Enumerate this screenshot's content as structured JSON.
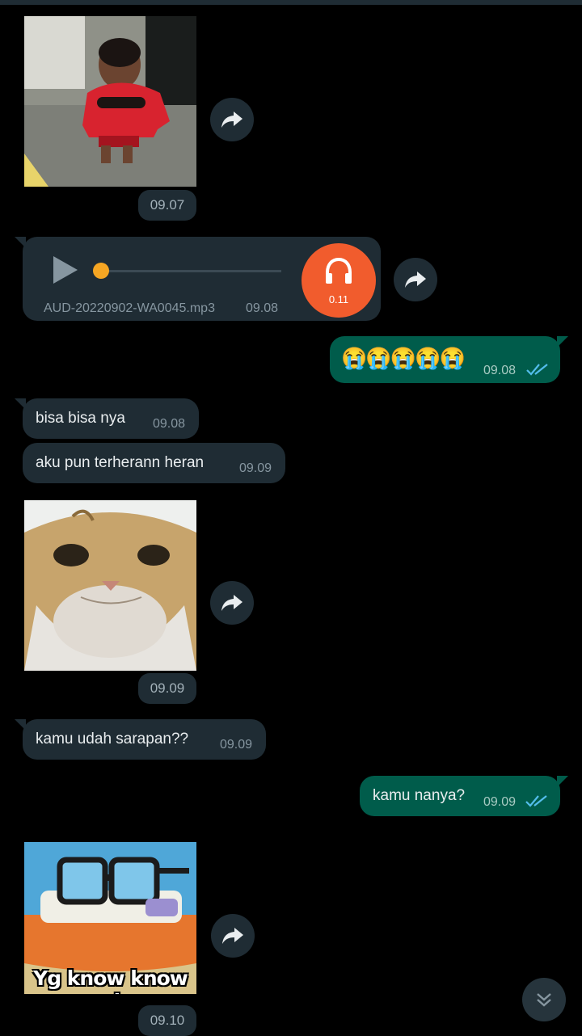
{
  "messages": {
    "img1_time": "09.07",
    "audio": {
      "filename": "AUD-20220902-WA0045.mp3",
      "time": "09.08",
      "duration": "0.11",
      "progress": 0
    },
    "out1": {
      "text": "😭😭😭😭😭",
      "time": "09.08"
    },
    "in1": {
      "text": "bisa bisa nya",
      "time": "09.08"
    },
    "in2": {
      "text": "aku pun terherann heran",
      "time": "09.09"
    },
    "img2_time": "09.09",
    "in3": {
      "text": "kamu udah sarapan??",
      "time": "09.09"
    },
    "out2": {
      "text": "kamu nanya?",
      "time": "09.09"
    },
    "img3": {
      "caption": "Yg know know aj",
      "time": "09.10"
    }
  },
  "colors": {
    "background": "#000000",
    "incoming_bubble": "#1f2c34",
    "outgoing_bubble": "#005c4b",
    "read_ticks": "#53bdeb",
    "audio_accent": "#f15c2d",
    "progress_dot": "#f5a623"
  },
  "icons": [
    "forward-icon",
    "play-icon",
    "headphones-icon",
    "double-check-icon",
    "chevron-double-down-icon"
  ]
}
